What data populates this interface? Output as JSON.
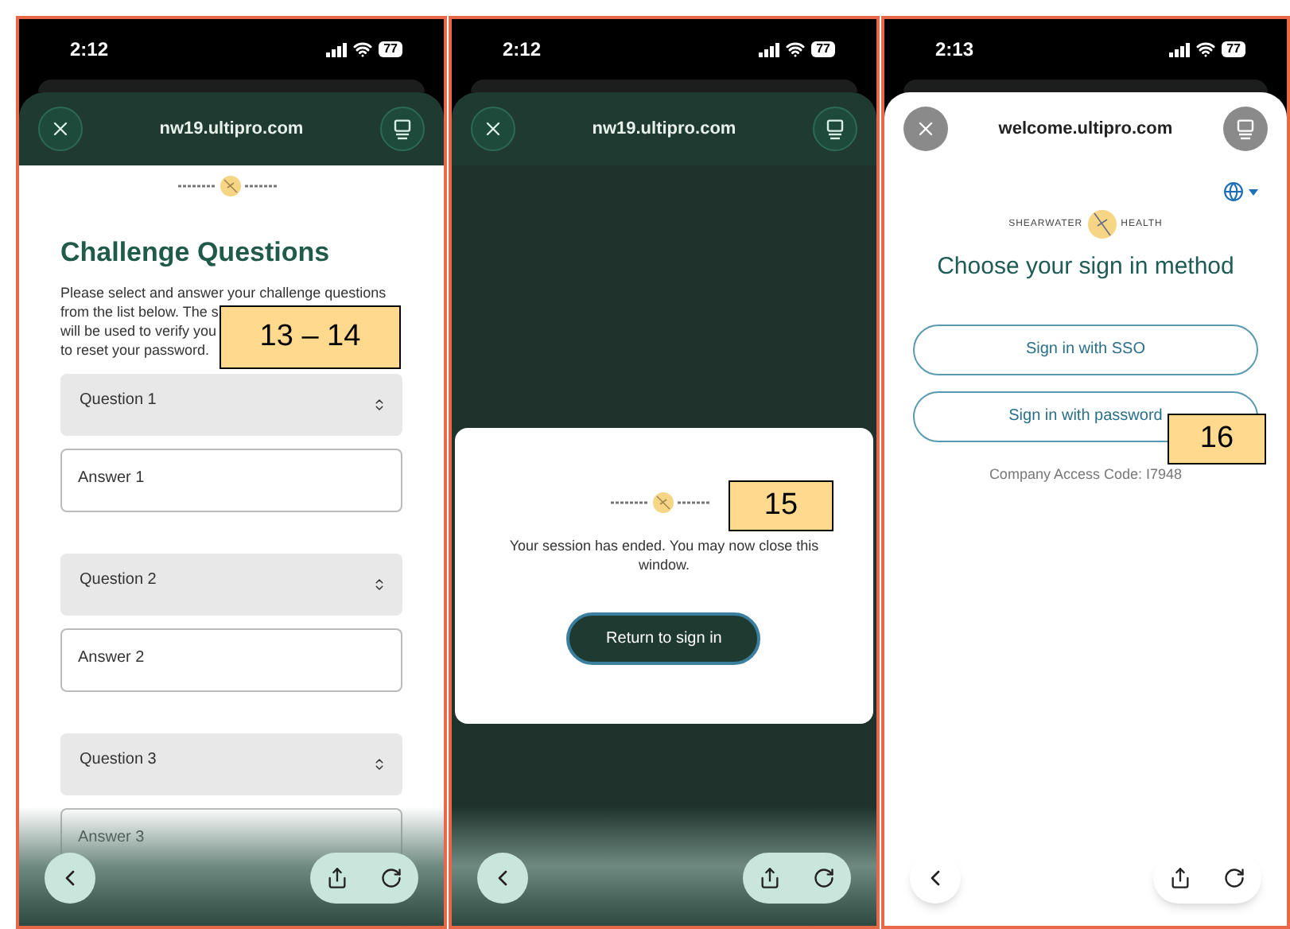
{
  "panels": [
    {
      "kind": "questions",
      "status": {
        "time": "2:12",
        "battery": "77"
      },
      "url": "nw19.ultipro.com",
      "heading": "Challenge Questions",
      "intro_lines": [
        "Please select and answer your challenge questions",
        "from the list below. The s",
        "will be used to verify you",
        "to reset your password."
      ],
      "fields": [
        {
          "kind": "select",
          "label": "Question 1"
        },
        {
          "kind": "input",
          "label": "Answer 1"
        },
        {
          "kind": "select",
          "label": "Question 2"
        },
        {
          "kind": "input",
          "label": "Answer 2"
        },
        {
          "kind": "select",
          "label": "Question 3"
        },
        {
          "kind": "input",
          "label": "Answer 3"
        }
      ],
      "callout": "13 – 14"
    },
    {
      "kind": "session_ended",
      "status": {
        "time": "2:12",
        "battery": "77"
      },
      "url": "nw19.ultipro.com",
      "message": "Your session has ended. You may now close this window.",
      "button": "Return to sign in",
      "callout": "15"
    },
    {
      "kind": "sign_in",
      "status": {
        "time": "2:13",
        "battery": "77"
      },
      "url": "welcome.ultipro.com",
      "logo": {
        "left": "SHEARWATER",
        "right": "HEALTH"
      },
      "heading": "Choose your sign in method",
      "buttons": [
        "Sign in with SSO",
        "Sign in with password"
      ],
      "access_code": "Company Access Code: I7948",
      "callout": "16"
    }
  ]
}
